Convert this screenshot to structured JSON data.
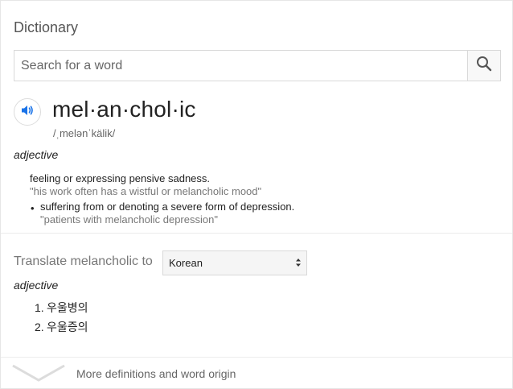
{
  "card_title": "Dictionary",
  "search": {
    "placeholder": "Search for a word",
    "value": "",
    "icon": "search-icon"
  },
  "entry": {
    "word": "mel·an·chol·ic",
    "phonetic": "/ˌmelənˈkälik/",
    "part_of_speech": "adjective",
    "definitions": [
      {
        "text": "feeling or expressing pensive sadness.",
        "example": "\"his work often has a wistful or melancholic mood\""
      },
      {
        "text": "suffering from or denoting a severe form of depression.",
        "example": "\"patients with melancholic depression\""
      }
    ]
  },
  "translate": {
    "label": "Translate melancholic to",
    "selected_language": "Korean",
    "part_of_speech": "adjective",
    "items": [
      {
        "num": "1.",
        "text": "우울병의"
      },
      {
        "num": "2.",
        "text": "우울증의"
      }
    ]
  },
  "footer": {
    "more_label": "More definitions and word origin"
  },
  "colors": {
    "accent": "#1a73e8",
    "muted_text": "#777777",
    "border": "#d9d9d9"
  }
}
